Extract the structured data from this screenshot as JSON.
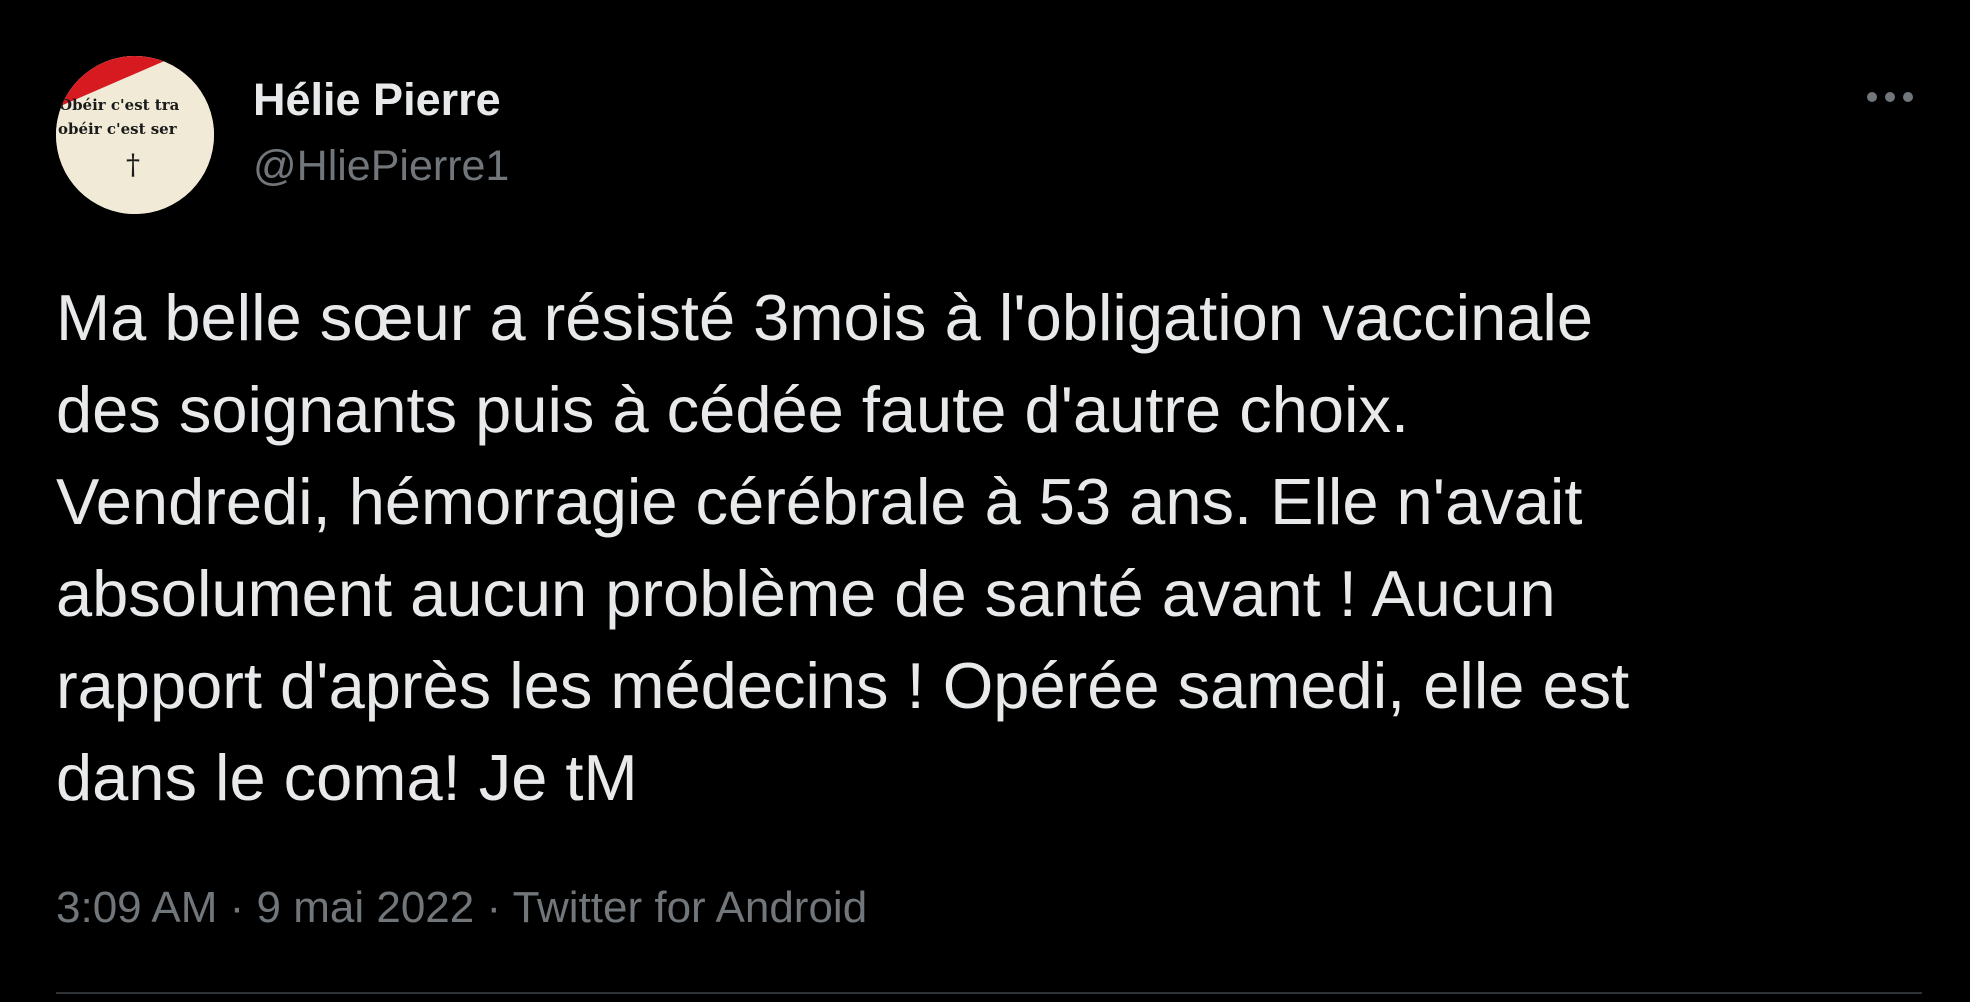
{
  "author": {
    "display_name": "Hélie Pierre",
    "handle": "@HliePierre1",
    "avatar_text": {
      "line1": "Obéir c'est tra",
      "line2": "obéir c'est ser",
      "symbol": "†"
    }
  },
  "menu": {
    "icon": "more-horizontal-icon"
  },
  "tweet": {
    "text": "Ma belle sœur a résisté 3mois à l'obligation vaccinale\ndes soignants puis à cédée faute d'autre choix.\nVendredi, hémorragie cérébrale à 53 ans. Elle n'avait\nabsolument aucun problème de santé avant ! Aucun\nrapport d'après les médecins ! Opérée samedi, elle est\ndans le coma! Je tM"
  },
  "meta": {
    "time": "3:09 AM",
    "separator1": " · ",
    "date": "9 mai 2022",
    "separator2": " · ",
    "source": "Twitter for Android"
  },
  "colors": {
    "background": "#000000",
    "primary_text": "#e7e9ea",
    "secondary_text": "#71767b",
    "divider": "#2f3336"
  }
}
